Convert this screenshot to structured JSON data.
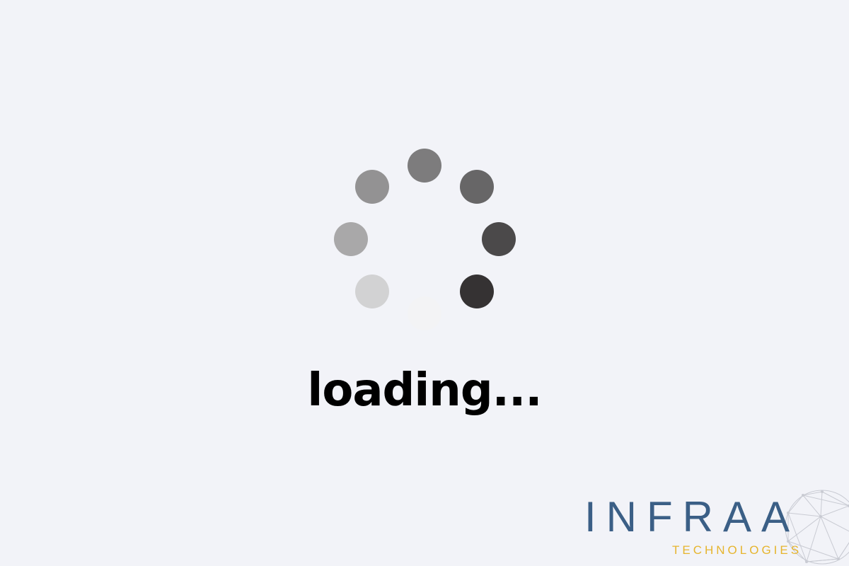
{
  "status": {
    "loading_text": "loading..."
  },
  "spinner": {
    "dots": [
      {
        "color": "#7d7c7d"
      },
      {
        "color": "#676667"
      },
      {
        "color": "#4b494a"
      },
      {
        "color": "#353233"
      },
      {
        "color": "#f3f3f5"
      },
      {
        "color": "#d2d2d3"
      },
      {
        "color": "#a9a8a9"
      },
      {
        "color": "#939293"
      }
    ]
  },
  "brand": {
    "name": "INFRAA",
    "tagline": "TECHNOLOGIES",
    "colors": {
      "name": "#3b5f86",
      "tagline": "#e6b52e"
    }
  }
}
